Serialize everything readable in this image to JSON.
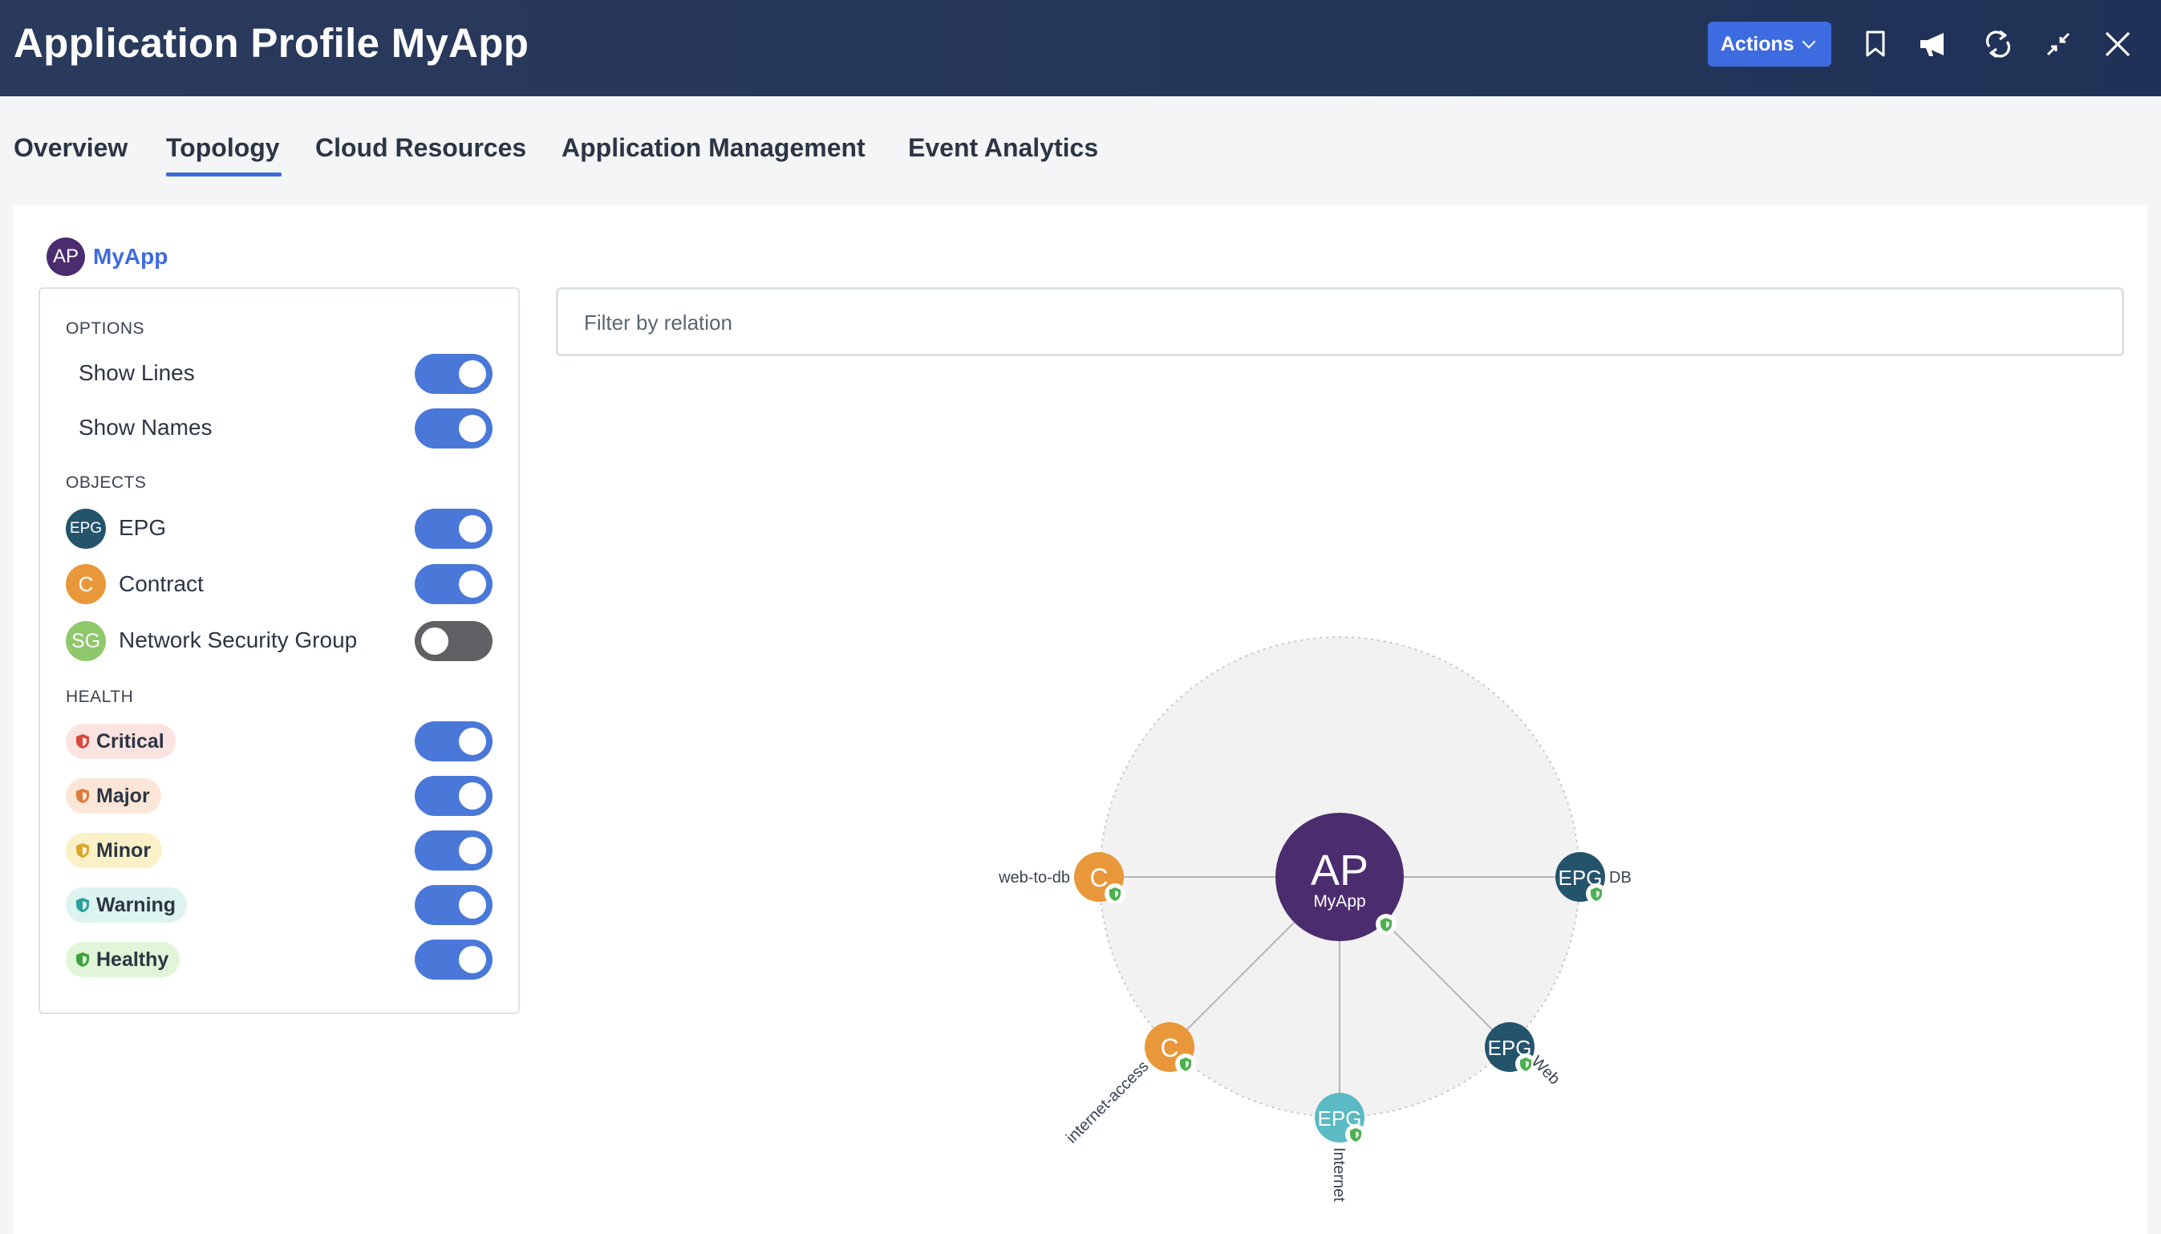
{
  "header": {
    "title": "Application Profile MyApp",
    "actions_label": "Actions",
    "icons": [
      "bookmark-icon",
      "announcement-icon",
      "refresh-icon",
      "minimize-icon",
      "close-icon"
    ]
  },
  "tabs": [
    {
      "label": "Overview",
      "active": false
    },
    {
      "label": "Topology",
      "active": true
    },
    {
      "label": "Cloud Resources",
      "active": false
    },
    {
      "label": "Application Management",
      "active": false
    },
    {
      "label": "Event Analytics",
      "active": false
    }
  ],
  "breadcrumb": {
    "avatar": "AP",
    "label": "MyApp"
  },
  "options": {
    "title": "OPTIONS",
    "items": [
      {
        "label": "Show Lines",
        "on": true
      },
      {
        "label": "Show Names",
        "on": true
      }
    ]
  },
  "objects": {
    "title": "OBJECTS",
    "items": [
      {
        "icon": "EPG",
        "label": "EPG",
        "on": true,
        "color": "#24546c"
      },
      {
        "icon": "C",
        "label": "Contract",
        "on": true,
        "color": "#e8983a"
      },
      {
        "icon": "SG",
        "label": "Network Security Group",
        "on": false,
        "color": "#8fc76b"
      }
    ]
  },
  "health": {
    "title": "HEALTH",
    "items": [
      {
        "label": "Critical",
        "on": true,
        "bg": "#fbe3e1",
        "icon_color": "#d9453d"
      },
      {
        "label": "Major",
        "on": true,
        "bg": "#fbe6d8",
        "icon_color": "#de7a3a"
      },
      {
        "label": "Minor",
        "on": true,
        "bg": "#fbf1c8",
        "icon_color": "#d9a72a"
      },
      {
        "label": "Warning",
        "on": true,
        "bg": "#dcf3ef",
        "icon_color": "#2aa198"
      },
      {
        "label": "Healthy",
        "on": true,
        "bg": "#e1f5d8",
        "icon_color": "#3aa33a"
      }
    ]
  },
  "filter": {
    "placeholder": "Filter by relation"
  },
  "topology": {
    "center": {
      "abbr": "AP",
      "name": "MyApp",
      "color": "#4b2c6e"
    },
    "nodes": [
      {
        "abbr": "C",
        "name": "web-to-db",
        "color": "#e8983a"
      },
      {
        "abbr": "EPG",
        "name": "DB",
        "color": "#24546c"
      },
      {
        "abbr": "C",
        "name": "internet-access",
        "color": "#e8983a"
      },
      {
        "abbr": "EPG",
        "name": "Internet",
        "color": "#5bbac4"
      },
      {
        "abbr": "EPG",
        "name": "Web",
        "color": "#24546c"
      }
    ]
  }
}
